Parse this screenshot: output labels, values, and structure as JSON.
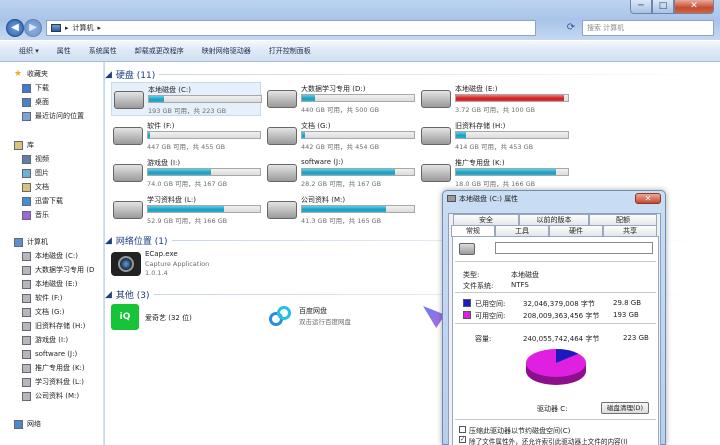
{
  "window": {
    "controls": {
      "minimize": "─",
      "maximize": "□",
      "close": "✕"
    }
  },
  "address": {
    "back": "◀",
    "forward": "▶",
    "path": [
      "▸",
      "计算机",
      "▸"
    ],
    "search_placeholder": "搜索 计算机"
  },
  "toolbar": {
    "items": [
      "组织 ▾",
      "属性",
      "系统属性",
      "卸载或更改程序",
      "映射网络驱动器",
      "打开控制面板"
    ]
  },
  "sidebar": {
    "favorites": {
      "title": "收藏夹",
      "items": [
        "下载",
        "桌面",
        "最近访问的位置"
      ]
    },
    "libraries": {
      "title": "库",
      "items": [
        "视频",
        "图片",
        "文档",
        "迅雷下载",
        "音乐"
      ]
    },
    "computer": {
      "title": "计算机",
      "items": [
        "本地磁盘 (C:)",
        "大数据学习专用 (D",
        "本地磁盘 (E:)",
        "软件 (F:)",
        "文档 (G:)",
        "旧资料存储 (H:)",
        "游戏盘 (I:)",
        "software (J:)",
        "推广专用盘 (K:)",
        "学习资料盘 (L:)",
        "公司资料 (M:)"
      ]
    },
    "network": {
      "title": "网络"
    }
  },
  "sections": {
    "hard_disks": "硬盘 (11)",
    "network": "网络位置 (1)",
    "other": "其他 (3)"
  },
  "drives": [
    {
      "name": "本地磁盘 (C:)",
      "info": "193 GB 可用，共 223 GB",
      "used": 0.13,
      "red": false,
      "sel": true
    },
    {
      "name": "大数据学习专用 (D:)",
      "info": "440 GB 可用，共 500 GB",
      "used": 0.12,
      "red": false
    },
    {
      "name": "本地磁盘 (E:)",
      "info": "3.72 GB 可用，共 100 GB",
      "used": 0.96,
      "red": true
    },
    {
      "name": "软件 (F:)",
      "info": "447 GB 可用，共 455 GB",
      "used": 0.02,
      "red": false
    },
    {
      "name": "文档 (G:)",
      "info": "442 GB 可用，共 454 GB",
      "used": 0.03,
      "red": false
    },
    {
      "name": "旧资料存储 (H:)",
      "info": "414 GB 可用，共 453 GB",
      "used": 0.09,
      "red": false
    },
    {
      "name": "游戏盘 (I:)",
      "info": "74.0 GB 可用，共 167 GB",
      "used": 0.56,
      "red": false
    },
    {
      "name": "software (J:)",
      "info": "28.2 GB 可用，共 167 GB",
      "used": 0.83,
      "red": false
    },
    {
      "name": "推广专用盘 (K:)",
      "info": "18.0 GB 可用，共 166 GB",
      "used": 0.89,
      "red": false
    },
    {
      "name": "学习资料盘 (L:)",
      "info": "52.9 GB 可用，共 166 GB",
      "used": 0.68,
      "red": false
    },
    {
      "name": "公司资料 (M:)",
      "info": "41.3 GB 可用，共 165 GB",
      "used": 0.75,
      "red": false
    }
  ],
  "network_item": {
    "name": "ECap.exe",
    "type": "Capture Application",
    "version": "1.0.1.4"
  },
  "other_items": [
    {
      "name": "爱奇艺 (32 位)"
    },
    {
      "name": "百度网盘",
      "sub": "双击运行百度网盘"
    }
  ],
  "dialog": {
    "title": "本地磁盘 (C:) 属性",
    "close": "✕",
    "tabs_top": [
      "安全",
      "以前的版本",
      "配额"
    ],
    "tabs_bottom": [
      "常规",
      "工具",
      "硬件",
      "共享"
    ],
    "type_label": "类型:",
    "type_value": "本地磁盘",
    "fs_label": "文件系统:",
    "fs_value": "NTFS",
    "used_label": "已用空间:",
    "used_bytes": "32,046,379,008 字节",
    "used_gb": "29.8 GB",
    "free_label": "可用空间:",
    "free_bytes": "208,009,363,456 字节",
    "free_gb": "193 GB",
    "cap_label": "容量:",
    "cap_bytes": "240,055,742,464 字节",
    "cap_gb": "223 GB",
    "drive_label": "驱动器 C:",
    "cleanup": "磁盘清理(D)",
    "compress": "压缩此驱动器以节约磁盘空间(C)",
    "index": "除了文件属性外，还允许索引此驱动器上文件的内容(I)",
    "used_fraction": 0.133,
    "colors": {
      "used": "#1b1bbd",
      "free": "#e020e0"
    }
  }
}
